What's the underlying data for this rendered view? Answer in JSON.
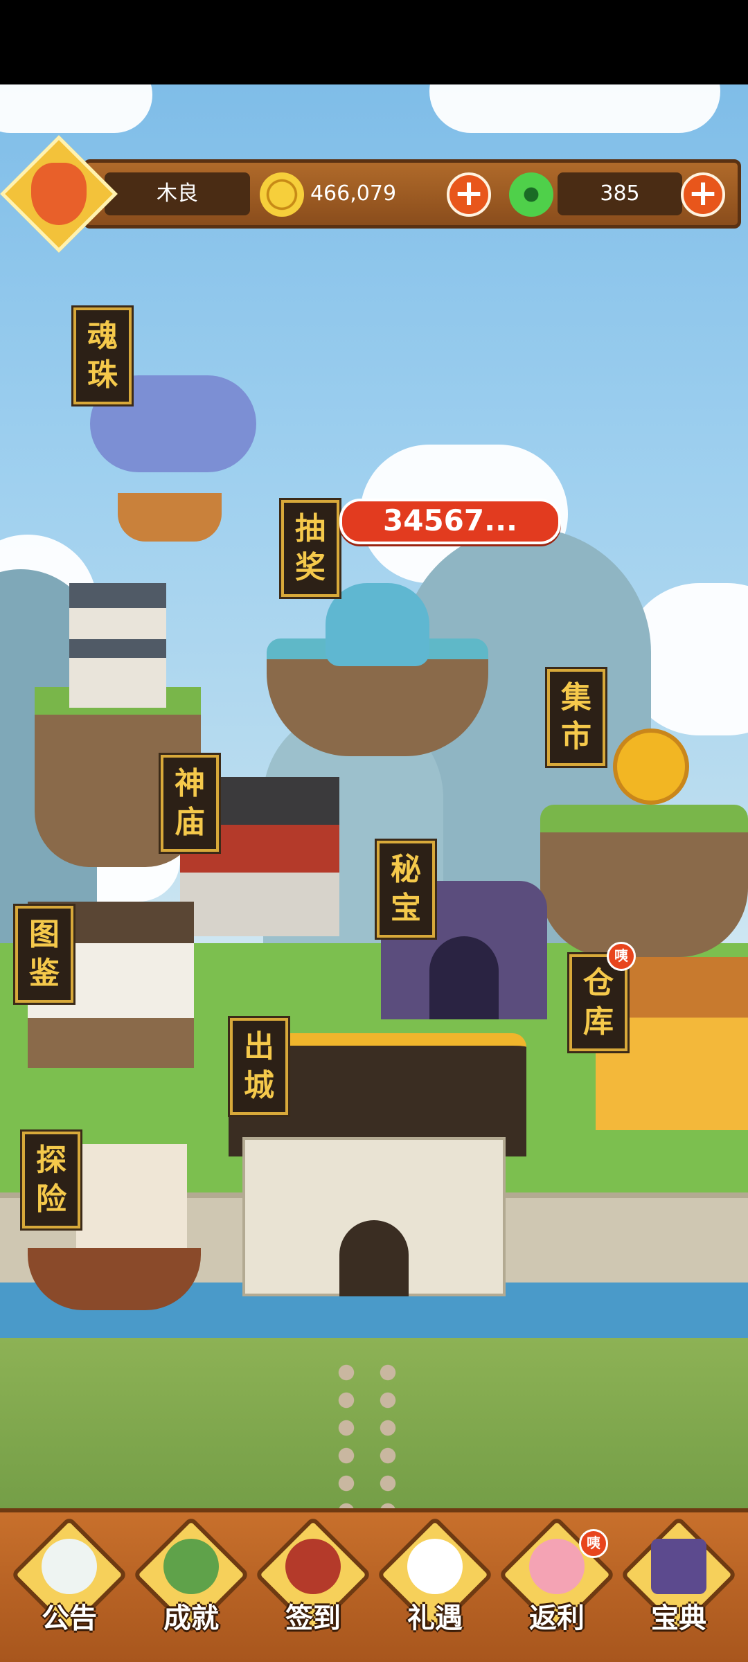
{
  "player": {
    "name": "木良",
    "coins": "466,079",
    "jade": "385"
  },
  "lottery": {
    "counter": "34567..."
  },
  "buildings": [
    {
      "id": "soul-orb",
      "label": [
        "魂",
        "珠"
      ]
    },
    {
      "id": "lottery",
      "label": [
        "抽",
        "奖"
      ]
    },
    {
      "id": "market",
      "label": [
        "集",
        "市"
      ]
    },
    {
      "id": "temple",
      "label": [
        "神",
        "庙"
      ]
    },
    {
      "id": "secret",
      "label": [
        "秘",
        "宝"
      ]
    },
    {
      "id": "codex",
      "label": [
        "图",
        "鉴"
      ]
    },
    {
      "id": "warehouse",
      "label": [
        "仓",
        "库"
      ],
      "badge": "咦"
    },
    {
      "id": "leave-city",
      "label": [
        "出",
        "城"
      ]
    },
    {
      "id": "explore",
      "label": [
        "探",
        "险"
      ]
    }
  ],
  "nav": [
    {
      "label": "公告",
      "icon": "scroll-icon"
    },
    {
      "label": "成就",
      "icon": "achievement-statue-icon"
    },
    {
      "label": "签到",
      "icon": "gate-icon"
    },
    {
      "label": "礼遇",
      "icon": "lucky-cat-icon"
    },
    {
      "label": "返利",
      "icon": "piggy-bank-icon",
      "badge": "咦"
    },
    {
      "label": "宝典",
      "icon": "book-icon"
    }
  ],
  "colors": {
    "accent": "#e8561b",
    "sign_text": "#f5c94b",
    "sign_bg": "#2c2016",
    "bar": "#8a4d1c"
  }
}
